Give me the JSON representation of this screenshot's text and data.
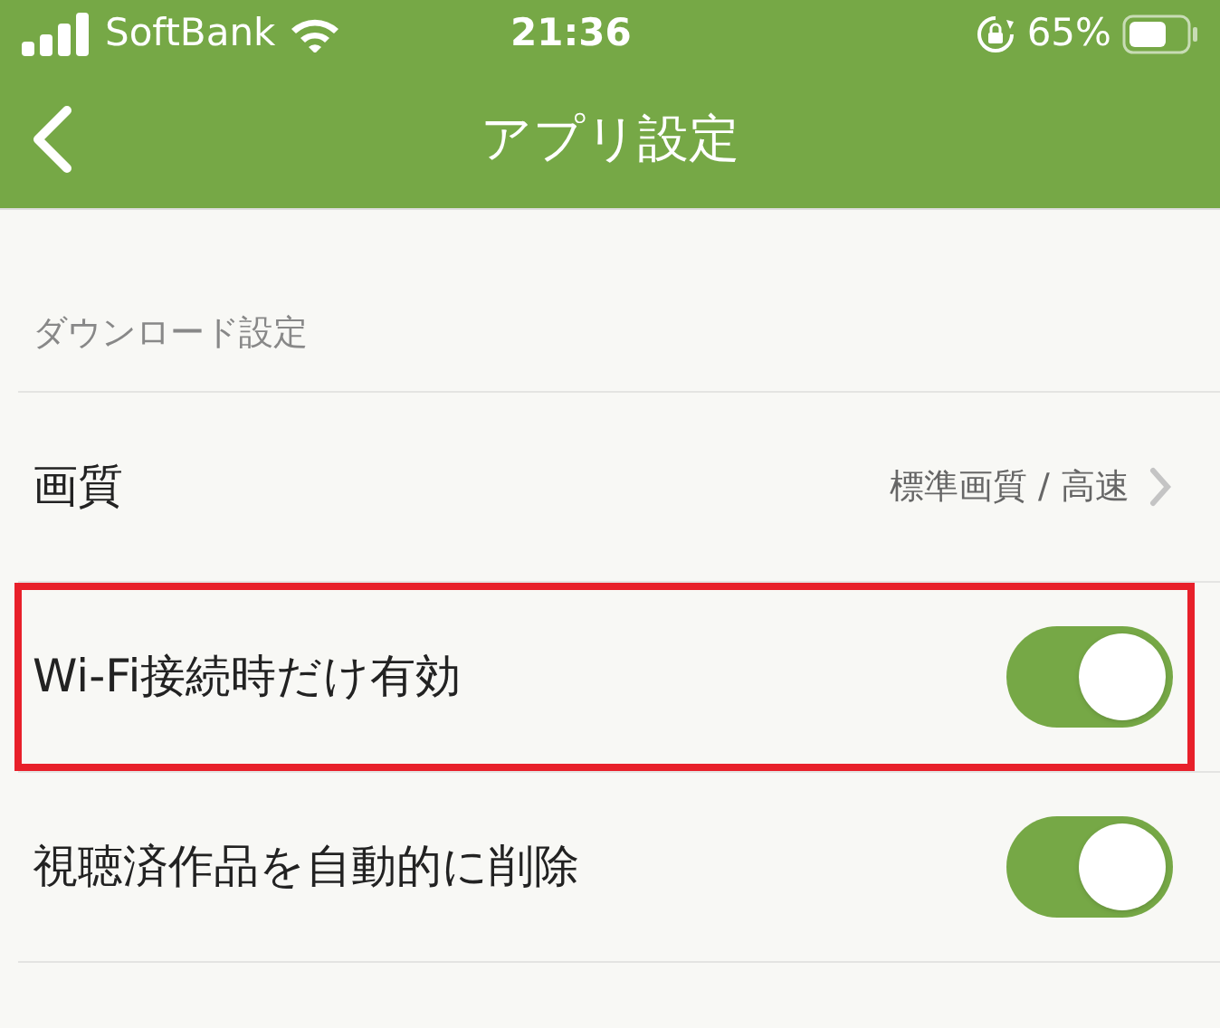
{
  "status_bar": {
    "carrier": "SoftBank",
    "time": "21:36",
    "battery_percent": "65%"
  },
  "nav_bar": {
    "title": "アプリ設定"
  },
  "section": {
    "header": "ダウンロード設定",
    "rows": [
      {
        "kind": "link",
        "label": "画質",
        "value": "標準画質 / 高速",
        "highlighted": false
      },
      {
        "kind": "toggle",
        "label": "Wi-Fi接続時だけ有効",
        "on": true,
        "highlighted": true
      },
      {
        "kind": "toggle",
        "label": "視聴済作品を自動的に削除",
        "on": true,
        "highlighted": false
      }
    ]
  }
}
